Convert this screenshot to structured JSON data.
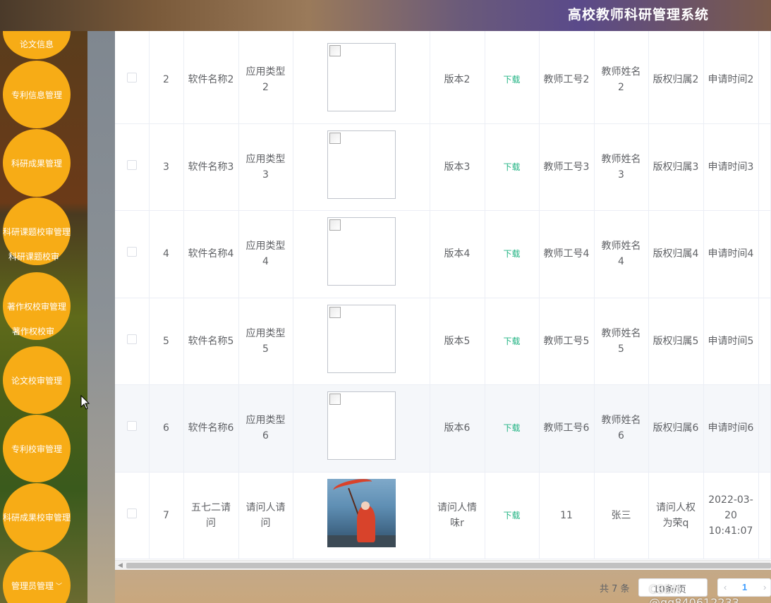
{
  "header": {
    "title": "高校教师科研管理系统"
  },
  "sidebar": {
    "items": [
      {
        "label": "论文信息"
      },
      {
        "label": "专利信息管理"
      },
      {
        "label": "科研成果管理"
      },
      {
        "label": "科研课题校审管理",
        "sub": "科研课题校审"
      },
      {
        "label": "著作权校审管理",
        "sub": "著作权校审"
      },
      {
        "label": "论文校审管理"
      },
      {
        "label": "专利校审管理"
      },
      {
        "label": "科研成果校审管理"
      },
      {
        "label": "管理员管理"
      }
    ]
  },
  "table": {
    "image_state": {
      "broken": "broken-image",
      "photo": "photo"
    },
    "rows": [
      {
        "index": "2",
        "name": "软件名称2",
        "type": "应用类型2",
        "image": "broken",
        "version": "版本2",
        "download": "下载",
        "teacher_no": "教师工号2",
        "teacher_name": "教师姓名2",
        "copyright": "版权归属2",
        "apply_time": "申请时间2"
      },
      {
        "index": "3",
        "name": "软件名称3",
        "type": "应用类型3",
        "image": "broken",
        "version": "版本3",
        "download": "下载",
        "teacher_no": "教师工号3",
        "teacher_name": "教师姓名3",
        "copyright": "版权归属3",
        "apply_time": "申请时间3"
      },
      {
        "index": "4",
        "name": "软件名称4",
        "type": "应用类型4",
        "image": "broken",
        "version": "版本4",
        "download": "下载",
        "teacher_no": "教师工号4",
        "teacher_name": "教师姓名4",
        "copyright": "版权归属4",
        "apply_time": "申请时间4"
      },
      {
        "index": "5",
        "name": "软件名称5",
        "type": "应用类型5",
        "image": "broken",
        "version": "版本5",
        "download": "下载",
        "teacher_no": "教师工号5",
        "teacher_name": "教师姓名5",
        "copyright": "版权归属5",
        "apply_time": "申请时间5"
      },
      {
        "index": "6",
        "name": "软件名称6",
        "type": "应用类型6",
        "image": "broken",
        "version": "版本6",
        "download": "下载",
        "teacher_no": "教师工号6",
        "teacher_name": "教师姓名6",
        "copyright": "版权归属6",
        "apply_time": "申请时间6"
      },
      {
        "index": "7",
        "name": "五七二请问",
        "type": "请问人请问",
        "image": "photo",
        "version": "请问人情味r",
        "download": "下载",
        "teacher_no": "11",
        "teacher_name": "张三",
        "copyright": "请问人权为荣q",
        "apply_time": "2022-03-20 10:41:07"
      }
    ]
  },
  "pagination": {
    "total": "共 7 条",
    "page_size": "10条/页",
    "current_page": "1"
  },
  "watermark": "CSDN @qq840612233",
  "colors": {
    "menu_circle": "#f7ac16",
    "download_link": "#21b383",
    "highlight_row": "#f5f7fa"
  }
}
